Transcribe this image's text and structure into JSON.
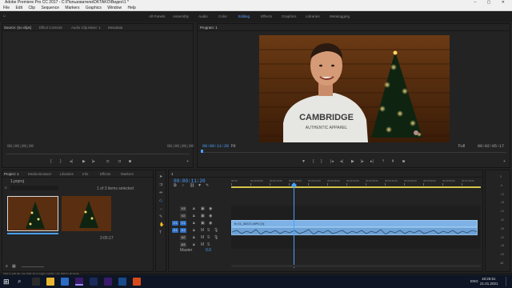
{
  "window": {
    "title": "Adobe Premiere Pro CC 2017 - C:\\Пользователи\\DKTAKO\\Видео\\1 *"
  },
  "menu": [
    "File",
    "Edit",
    "Clip",
    "Sequence",
    "Markers",
    "Graphics",
    "Window",
    "Help"
  ],
  "workspaces": [
    {
      "label": "All Panels",
      "active": false
    },
    {
      "label": "Assembly",
      "active": false
    },
    {
      "label": "Audio",
      "active": false
    },
    {
      "label": "Color",
      "active": false
    },
    {
      "label": "Editing",
      "active": true
    },
    {
      "label": "Effects",
      "active": false
    },
    {
      "label": "Graphics",
      "active": false
    },
    {
      "label": "Libraries",
      "active": false
    },
    {
      "label": "Metalogging",
      "active": false
    }
  ],
  "source_panel": {
    "tabs": [
      "Source: (no clips)",
      "Effect Controls",
      "Audio Clip Mixer: 1",
      "Metadata"
    ],
    "timecode_left": "00;00;00;00",
    "timecode_right": "00;00;00;00"
  },
  "program_panel": {
    "tab": "Program: 1",
    "timecode": "00:00:11:20",
    "fit": "Fit",
    "duration": "00:02:05:17",
    "quality": "Full",
    "video_text": {
      "shirt_top": "CAMBRIDGE",
      "shirt_bottom": "AUTHENTIC APPAREL"
    }
  },
  "project_panel": {
    "tabs": [
      "Project: 1",
      "Media Browser",
      "Libraries",
      "Info",
      "Effects",
      "Markers"
    ],
    "bin": "1.prproj",
    "search_placeholder": "",
    "item_count": "1 of 3 items selected",
    "items": [
      {
        "name": "",
        "duration": ""
      },
      {
        "name": "",
        "duration": "2:05:17"
      }
    ]
  },
  "timeline": {
    "tab": "1",
    "timecode": "00:00:11:20",
    "ruler": [
      "00:00",
      "00:00:05:00",
      "00:00:10:00",
      "00:00:15:00",
      "00:00:20:00",
      "00:00:25:00",
      "00:00:30:00",
      "00:00:35:00",
      "00:00:40:00",
      "00:00:45:00",
      "00:00:50:00",
      "00:00:55:00",
      "00:01:00:00"
    ],
    "tracks": [
      {
        "id": "V3",
        "kind": "video"
      },
      {
        "id": "V2",
        "kind": "video"
      },
      {
        "id": "V1",
        "kind": "video"
      },
      {
        "id": "A1",
        "kind": "audio"
      },
      {
        "id": "A2",
        "kind": "audio"
      },
      {
        "id": "A3",
        "kind": "audio"
      }
    ],
    "master": {
      "label": "Master",
      "value": "0.0"
    },
    "video_clip": "fx 01_08371.MP4 [V]",
    "playhead_fraction": 0.25
  },
  "audio_meter": {
    "scale": [
      "0",
      "-6",
      "-12",
      "-18",
      "-24",
      "-30",
      "-36",
      "-42",
      "-48",
      "-54",
      "dB"
    ]
  },
  "status_bar": {
    "text": "Click to split clip. Use Shift, Alt to toggle modifier. Use Shift for all tracks."
  },
  "taskbar": {
    "lang": "ENG",
    "time": "18:26:51",
    "date": "21.01.2021"
  },
  "colors": {
    "accent": "#4aa0ff",
    "clip_video": "#7eb2e6",
    "clip_audio": "#6ea2d6",
    "panel": "#232323"
  }
}
